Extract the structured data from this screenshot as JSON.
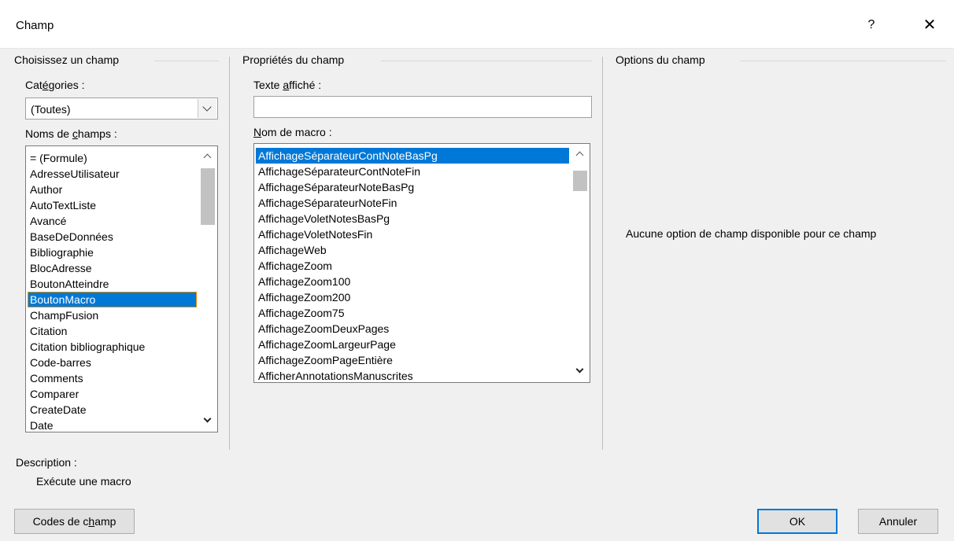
{
  "window": {
    "title": "Champ",
    "help_label": "?",
    "close_label": "✕"
  },
  "left_group": {
    "title": "Choisissez un champ",
    "categories_label": "Catégories :",
    "categories_value": "(Toutes)",
    "names_label": "Noms de champs :",
    "field_names": [
      "= (Formule)",
      "AdresseUtilisateur",
      "Author",
      "AutoTextListe",
      "Avancé",
      "BaseDeDonnées",
      "Bibliographie",
      "BlocAdresse",
      "BoutonAtteindre",
      "BoutonMacro",
      "ChampFusion",
      "Citation",
      "Citation bibliographique",
      "Code-barres",
      "Comments",
      "Comparer",
      "CreateDate",
      "Date"
    ],
    "selected_field": "BoutonMacro"
  },
  "middle_group": {
    "title": "Propriétés du champ",
    "display_text_label": "Texte affiché :",
    "display_text_value": "",
    "macro_label": "Nom de macro :",
    "macro_names": [
      "AffichageSéparateurContNoteBasPg",
      "AffichageSéparateurContNoteFin",
      "AffichageSéparateurNoteBasPg",
      "AffichageSéparateurNoteFin",
      "AffichageVoletNotesBasPg",
      "AffichageVoletNotesFin",
      "AffichageWeb",
      "AffichageZoom",
      "AffichageZoom100",
      "AffichageZoom200",
      "AffichageZoom75",
      "AffichageZoomDeuxPages",
      "AffichageZoomLargeurPage",
      "AffichageZoomPageEntière",
      "AfficherAnnotationsManuscrites"
    ],
    "selected_macro": "AffichageSéparateurContNoteBasPg"
  },
  "right_group": {
    "title": "Options du champ",
    "message": "Aucune option de champ disponible pour ce champ"
  },
  "description": {
    "label": "Description :",
    "text": "Exécute une macro"
  },
  "buttons": {
    "field_codes": "Codes de champ",
    "ok": "OK",
    "cancel": "Annuler"
  },
  "colors": {
    "selection": "#0078d7",
    "focus_outline": "#e48c00",
    "default_button_border": "#0078d7"
  }
}
